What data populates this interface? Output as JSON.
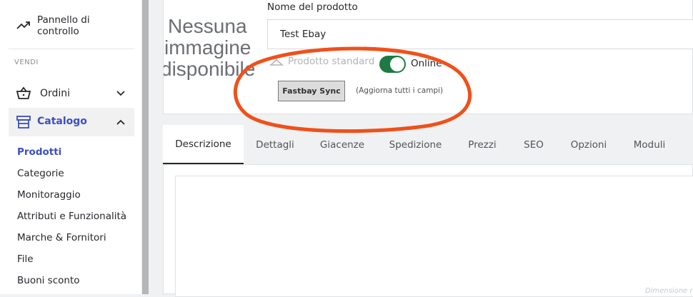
{
  "sidebar": {
    "dashboard_label": "Pannello di controllo",
    "dashboard_line1": "Pannello di",
    "dashboard_line2": "controllo",
    "section_sell": "VENDI",
    "orders_label": "Ordini",
    "catalog_label": "Catalogo",
    "catalog_items": [
      "Prodotti",
      "Categorie",
      "Monitoraggio",
      "Attributi e Funzionalità",
      "Marche & Fornitori",
      "File",
      "Buoni sconto"
    ],
    "active_item": "Prodotti"
  },
  "product": {
    "no_image_line1": "Nessuna",
    "no_image_line2": "immagine",
    "no_image_line3": "disponibile",
    "name_label": "Nome del prodotto",
    "name_value": "Test Ebay",
    "type_label": "Prodotto standard",
    "online_label": "Online",
    "online_enabled": true,
    "sync_button": "Fastbay Sync",
    "sync_hint": "(Aggiorna tutti i campi)"
  },
  "tabs": [
    "Descrizione",
    "Dettagli",
    "Giacenze",
    "Spedizione",
    "Prezzi",
    "SEO",
    "Opzioni",
    "Moduli"
  ],
  "active_tab": "Descrizione",
  "editor": {
    "dimension_note": "Dimensione rac"
  },
  "colors": {
    "accent": "#25b9d7",
    "active_nav": "#3d4ec1",
    "toggle_on": "#1e7a43",
    "annotation": "#f0501a"
  }
}
